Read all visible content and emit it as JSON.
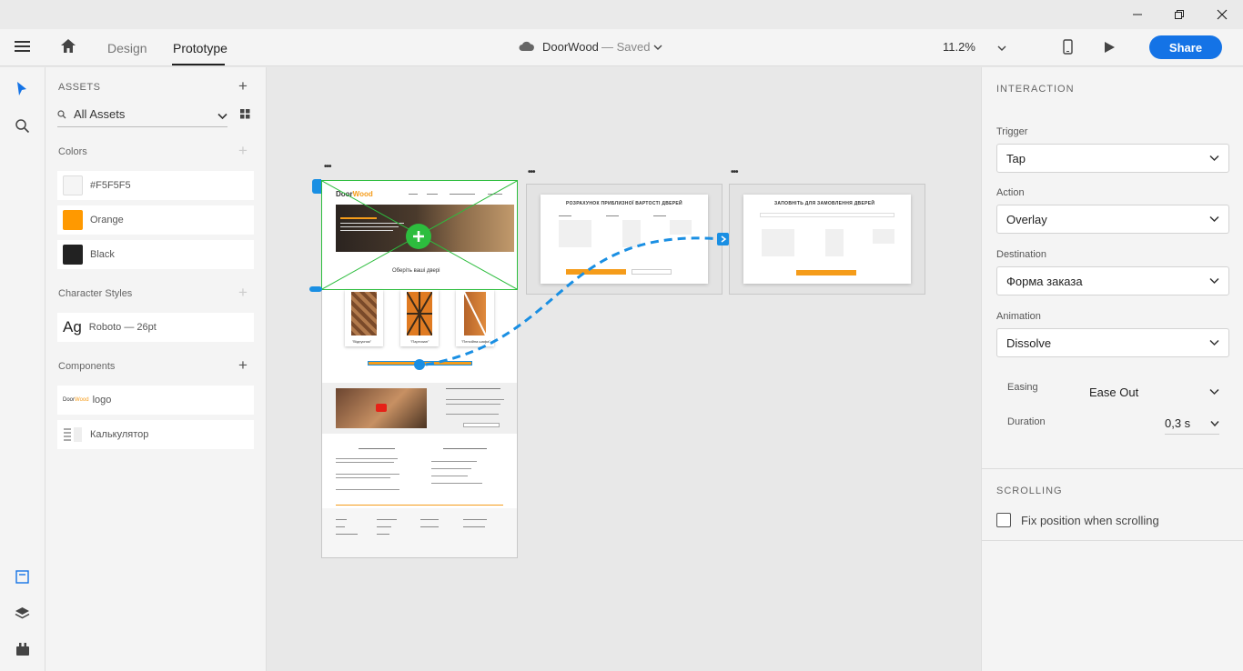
{
  "window": {
    "minimize_icon": "minimize-icon",
    "restore_icon": "restore-icon",
    "close_icon": "close-icon"
  },
  "header": {
    "tabs": [
      {
        "label": "Design"
      },
      {
        "label": "Prototype"
      }
    ],
    "doc_title": "DoorWood",
    "doc_status": "— Saved",
    "zoom": "11.2%",
    "share_label": "Share"
  },
  "assets": {
    "title": "ASSETS",
    "search_value": "All Assets",
    "colors_title": "Colors",
    "colors": [
      {
        "label": "#F5F5F5",
        "hex": "#F5F5F5"
      },
      {
        "label": "Orange",
        "hex": "#FF9900"
      },
      {
        "label": "Black",
        "hex": "#222222"
      }
    ],
    "char_styles_title": "Character Styles",
    "char_style": {
      "sample": "Ag",
      "label": "Roboto — 26pt"
    },
    "components_title": "Components",
    "components": [
      {
        "label": "logo"
      },
      {
        "label": "Калькулятор"
      }
    ]
  },
  "canvas": {
    "site": {
      "logo_a": "Door",
      "logo_b": "Wood",
      "hero_cta": "Оберіть ваші двері",
      "products": [
        "\"Відпусник\"",
        "\"Партизан\"",
        "\"Пенсійна шафа\""
      ]
    },
    "modal1_title": "РОЗРАХУНОК ПРИБЛИЗНОЇ ВАРТОСТІ ДВЕРЕЙ",
    "modal2_title": "ЗАПОВНІТЬ ДЛЯ ЗАМОВЛЕННЯ ДВЕРЕЙ"
  },
  "interaction": {
    "title": "INTERACTION",
    "trigger_label": "Trigger",
    "trigger_value": "Tap",
    "action_label": "Action",
    "action_value": "Overlay",
    "destination_label": "Destination",
    "destination_value": "Форма заказа",
    "animation_label": "Animation",
    "animation_value": "Dissolve",
    "easing_label": "Easing",
    "easing_value": "Ease Out",
    "duration_label": "Duration",
    "duration_value": "0,3 s"
  },
  "scrolling": {
    "title": "SCROLLING",
    "fix_label": "Fix position when scrolling",
    "fix_checked": false
  },
  "colors": {
    "accent": "#1473e6",
    "selection": "#2dbd3e",
    "wire": "#1a8fe3",
    "orange": "#f59c1a"
  }
}
